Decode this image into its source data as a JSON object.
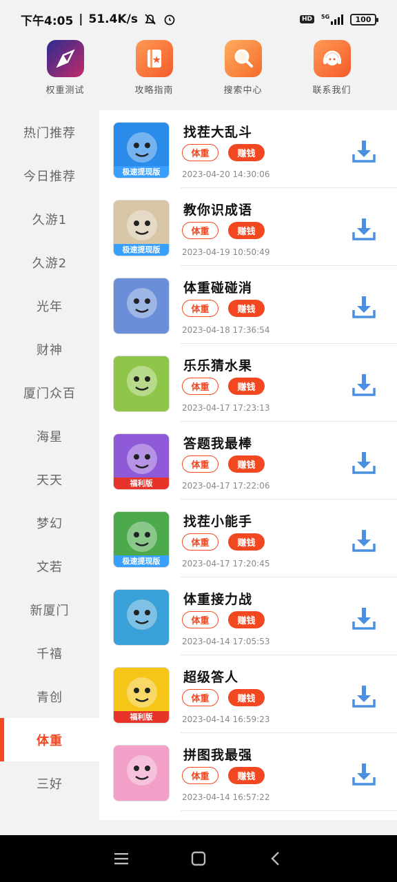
{
  "status": {
    "time": "下午4:05",
    "speed": "51.4K/s",
    "battery": "100",
    "hd": "HD",
    "net": "5G"
  },
  "top_nav": [
    {
      "label": "权重测试",
      "icon": "compass-icon",
      "color": "#3b3dbf"
    },
    {
      "label": "攻略指南",
      "icon": "book-icon",
      "color": "#ff7a45"
    },
    {
      "label": "搜索中心",
      "icon": "magnifier-icon",
      "color": "#ff8a3d"
    },
    {
      "label": "联系我们",
      "icon": "headset-icon",
      "color": "#ff7a45"
    }
  ],
  "sidebar": [
    {
      "label": "热门推荐"
    },
    {
      "label": "今日推荐"
    },
    {
      "label": "久游1"
    },
    {
      "label": "久游2"
    },
    {
      "label": "光年"
    },
    {
      "label": "财神"
    },
    {
      "label": "厦门众百"
    },
    {
      "label": "海星"
    },
    {
      "label": "天天"
    },
    {
      "label": "梦幻"
    },
    {
      "label": "文若"
    },
    {
      "label": "新厦门"
    },
    {
      "label": "千禧"
    },
    {
      "label": "青创"
    },
    {
      "label": "体重",
      "active": true
    },
    {
      "label": "三好"
    }
  ],
  "games": [
    {
      "title": "找茬大乱斗",
      "tag1": "体重",
      "tag2": "赚钱",
      "date": "2023-04-20  14:30:06",
      "ribbon": "极速提现版",
      "ribbon_color": "#3aa0ff",
      "bg": "#2a8be8"
    },
    {
      "title": "教你识成语",
      "tag1": "体重",
      "tag2": "赚钱",
      "date": "2023-04-19  10:50:49",
      "ribbon": "极速提现版",
      "ribbon_color": "#3aa0ff",
      "bg": "#d8c7a6"
    },
    {
      "title": "体重碰碰消",
      "tag1": "体重",
      "tag2": "赚钱",
      "date": "2023-04-18  17:36:54",
      "ribbon": "",
      "ribbon_color": "",
      "bg": "#6a8fd8"
    },
    {
      "title": "乐乐猜水果",
      "tag1": "体重",
      "tag2": "赚钱",
      "date": "2023-04-17  17:23:13",
      "ribbon": "",
      "ribbon_color": "",
      "bg": "#8fc64a"
    },
    {
      "title": "答题我最棒",
      "tag1": "体重",
      "tag2": "赚钱",
      "date": "2023-04-17  17:22:06",
      "ribbon": "福利版",
      "ribbon_color": "#e8332b",
      "bg": "#8f5ad8"
    },
    {
      "title": "找茬小能手",
      "tag1": "体重",
      "tag2": "赚钱",
      "date": "2023-04-17  17:20:45",
      "ribbon": "极速提现版",
      "ribbon_color": "#3aa0ff",
      "bg": "#4caa4c"
    },
    {
      "title": "体重接力战",
      "tag1": "体重",
      "tag2": "赚钱",
      "date": "2023-04-14  17:05:53",
      "ribbon": "",
      "ribbon_color": "",
      "bg": "#3aa0d8"
    },
    {
      "title": "超级答人",
      "tag1": "体重",
      "tag2": "赚钱",
      "date": "2023-04-14  16:59:23",
      "ribbon": "福利版",
      "ribbon_color": "#e8332b",
      "bg": "#f5c518"
    },
    {
      "title": "拼图我最强",
      "tag1": "体重",
      "tag2": "赚钱",
      "date": "2023-04-14  16:57:22",
      "ribbon": "",
      "ribbon_color": "",
      "bg": "#f2a0c8"
    }
  ],
  "colors": {
    "accent": "#f24822",
    "download": "#4a8fe0"
  }
}
